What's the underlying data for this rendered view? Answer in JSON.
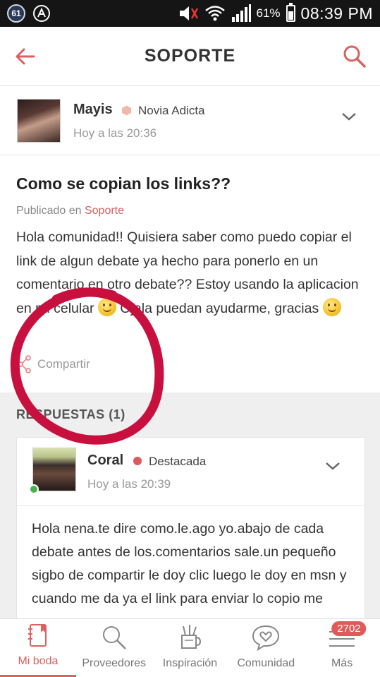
{
  "status_bar": {
    "notification_count": "61",
    "battery_percent": "61%",
    "battery_level": 0.61,
    "time": "08:39 PM"
  },
  "app_bar": {
    "title": "SOPORTE",
    "back_icon": "arrow-left-icon",
    "search_icon": "search-icon"
  },
  "author": {
    "name": "Mayis",
    "rank": "Novia Adicta",
    "time": "Hoy a las 20:36"
  },
  "post": {
    "title": "Como se copian los links??",
    "published_prefix": "Publicado en",
    "category": "Soporte",
    "body_part1": "Hola comunidad!! Quisiera saber como puedo copiar el link de algun debate ya hecho para ponerlo en un comentario en otro debate?? Estoy usando la aplicacion en mi celular",
    "body_part2": "Ojala puedan ayudarme, gracias",
    "share_label": "Compartir"
  },
  "responses": {
    "label": "RESPUESTAS (1)",
    "items": [
      {
        "name": "Coral",
        "rank": "Destacada",
        "time": "Hoy a las 20:39",
        "body": "Hola nena.te dire como.le.ago yo.abajo de cada debate antes de los.comentarios sale.un pequeño sigbo de compartir le doy clic luego le doy en msn y cuando me da ya el link para enviar lo copio me"
      }
    ]
  },
  "bottom_nav": {
    "items": [
      {
        "label": "Mi boda",
        "icon": "notebook-icon",
        "active": true
      },
      {
        "label": "Proveedores",
        "icon": "search-icon",
        "active": false
      },
      {
        "label": "Inspiración",
        "icon": "pencil-cup-icon",
        "active": false
      },
      {
        "label": "Comunidad",
        "icon": "chat-heart-icon",
        "active": false
      },
      {
        "label": "Más",
        "icon": "menu-icon",
        "active": false,
        "badge": "2702"
      }
    ]
  },
  "colors": {
    "accent": "#d9615f",
    "annotation": "#c8103f"
  }
}
